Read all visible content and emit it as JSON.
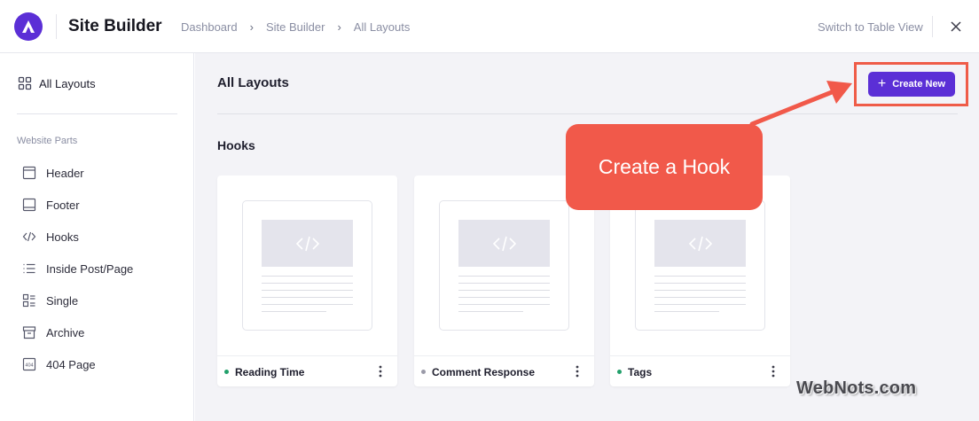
{
  "header": {
    "app_title": "Site Builder",
    "breadcrumbs": [
      "Dashboard",
      "Site Builder",
      "All Layouts"
    ],
    "switch_view": "Switch to Table View"
  },
  "sidebar": {
    "all_layouts": "All Layouts",
    "section_label": "Website Parts",
    "items": [
      {
        "label": "Header",
        "icon": "header-icon"
      },
      {
        "label": "Footer",
        "icon": "footer-icon"
      },
      {
        "label": "Hooks",
        "icon": "code-icon"
      },
      {
        "label": "Inside Post/Page",
        "icon": "list-icon"
      },
      {
        "label": "Single",
        "icon": "single-icon"
      },
      {
        "label": "Archive",
        "icon": "archive-icon"
      },
      {
        "label": "404 Page",
        "icon": "404-icon"
      }
    ]
  },
  "main": {
    "title": "All Layouts",
    "create_button": "Create New",
    "section_title": "Hooks",
    "cards": [
      {
        "name": "Reading Time",
        "status_color": "#22a06b"
      },
      {
        "name": "Comment Response",
        "status_color": "#9a9aa8"
      },
      {
        "name": "Tags",
        "status_color": "#22a06b"
      }
    ]
  },
  "annotation": {
    "callout": "Create a Hook",
    "color": "#f1594a"
  },
  "watermark": "WebNots.com",
  "colors": {
    "accent": "#5b2fd6",
    "highlight": "#ef5c48"
  }
}
